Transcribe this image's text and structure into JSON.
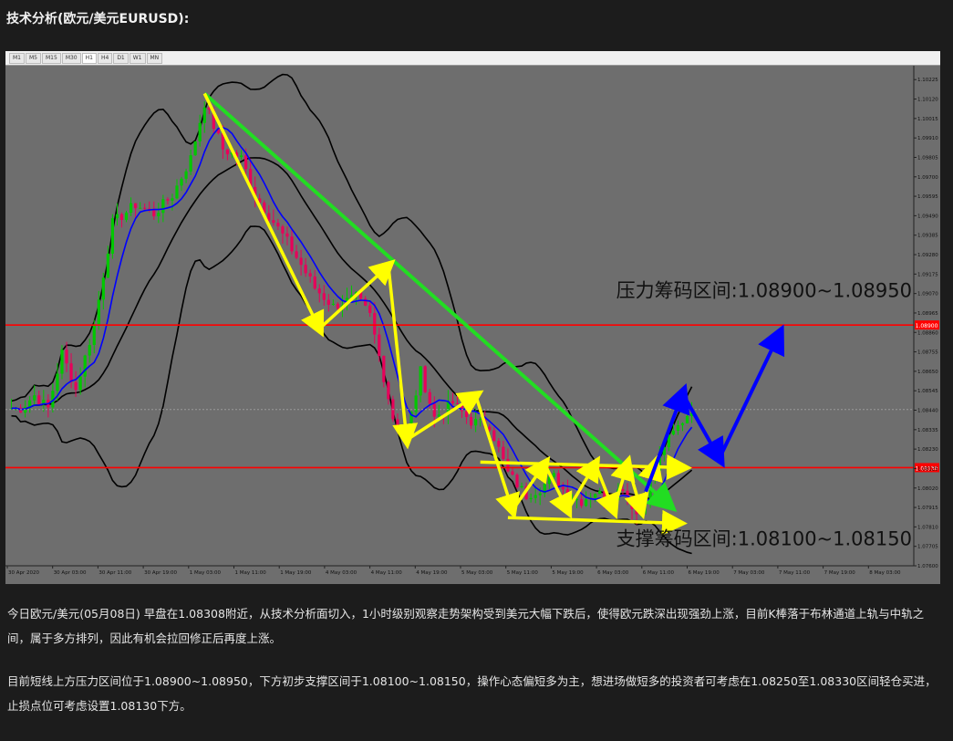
{
  "page": {
    "title": "技术分析(欧元/美元EURUSD):",
    "paragraphs": [
      "今日欧元/美元(05月08日) 早盘在1.08308附近，从技术分析面切入，1小时级别观察走势架构受到美元大幅下跌后，使得欧元跌深出现强劲上涨，目前K棒落于布林通道上轨与中轨之间，属于多方排列，因此有机会拉回修正后再度上涨。",
      "目前短线上方压力区间位于1.08900~1.08950，下方初步支撑区间于1.08100~1.08150，操作心态偏短多为主，想进场做短多的投资者可考虑在1.08250至1.08330区间轻仓买进，止损点位可考虑设置1.08130下方。"
    ]
  },
  "toolbar": {
    "timeframes": [
      "M1",
      "M5",
      "M15",
      "M30",
      "H1",
      "H4",
      "D1",
      "W1",
      "MN"
    ],
    "active": "H1"
  },
  "colors": {
    "background": "#6e6e6e",
    "bull_candle": "#00c800",
    "bear_candle": "#e8005a",
    "bollinger": "#000000",
    "ma": "#0000ff",
    "level_line": "#ff0000",
    "trend_line": "#22dd22",
    "pattern_line": "#ffff00",
    "forecast_line": "#0000ff"
  },
  "chart_data": {
    "type": "candlestick",
    "symbol": "EURUSD",
    "timeframe": "H1",
    "ylim": [
      1.076,
      1.103
    ],
    "y_ticks": [
      1.10225,
      1.1012,
      1.10015,
      1.0991,
      1.09805,
      1.097,
      1.09595,
      1.0949,
      1.09385,
      1.0928,
      1.09175,
      1.0907,
      1.08965,
      1.0886,
      1.08755,
      1.0865,
      1.08545,
      1.0844,
      1.08335,
      1.0823,
      1.08125,
      1.0802,
      1.07915,
      1.0781,
      1.07705,
      1.076
    ],
    "x_ticks": [
      "30 Apr 2020",
      "30 Apr 03:00",
      "30 Apr 11:00",
      "30 Apr 19:00",
      "1 May 03:00",
      "1 May 11:00",
      "1 May 19:00",
      "4 May 03:00",
      "4 May 11:00",
      "4 May 19:00",
      "5 May 03:00",
      "5 May 11:00",
      "5 May 19:00",
      "6 May 03:00",
      "6 May 11:00",
      "6 May 19:00",
      "7 May 03:00",
      "7 May 11:00",
      "7 May 19:00",
      "8 May 03:00"
    ],
    "current_price": 1.08444,
    "levels": [
      {
        "price": 1.089,
        "price_tag": "1.08900"
      },
      {
        "price": 1.0813,
        "price_tag": "1.08130"
      }
    ],
    "annotations": [
      {
        "text": "压力筹码区间:1.08900~1.08950",
        "price": 1.0905
      },
      {
        "text": "支撑筹码区间:1.08100~1.08150",
        "price": 1.0771
      }
    ],
    "pivots": [
      {
        "t": 2,
        "p": 1.0845
      },
      {
        "t": 5,
        "p": 1.0852
      },
      {
        "t": 8,
        "p": 1.0845
      },
      {
        "t": 11,
        "p": 1.0875
      },
      {
        "t": 14,
        "p": 1.0855
      },
      {
        "t": 18,
        "p": 1.089
      },
      {
        "t": 22,
        "p": 1.0945
      },
      {
        "t": 27,
        "p": 1.0955
      },
      {
        "t": 31,
        "p": 1.095
      },
      {
        "t": 35,
        "p": 1.096
      },
      {
        "t": 39,
        "p": 1.098
      },
      {
        "t": 42,
        "p": 1.101
      },
      {
        "t": 46,
        "p": 1.0985
      },
      {
        "t": 50,
        "p": 1.098
      },
      {
        "t": 53,
        "p": 1.096
      },
      {
        "t": 60,
        "p": 1.0935
      },
      {
        "t": 66,
        "p": 1.091
      },
      {
        "t": 70,
        "p": 1.09
      },
      {
        "t": 75,
        "p": 1.0905
      },
      {
        "t": 78,
        "p": 1.0895
      },
      {
        "t": 83,
        "p": 1.084
      },
      {
        "t": 86,
        "p": 1.083
      },
      {
        "t": 89,
        "p": 1.0865
      },
      {
        "t": 92,
        "p": 1.084
      },
      {
        "t": 96,
        "p": 1.0848
      },
      {
        "t": 100,
        "p": 1.0838
      },
      {
        "t": 104,
        "p": 1.0836
      },
      {
        "t": 108,
        "p": 1.081
      },
      {
        "t": 112,
        "p": 1.0798
      },
      {
        "t": 115,
        "p": 1.0802
      },
      {
        "t": 118,
        "p": 1.0808
      },
      {
        "t": 121,
        "p": 1.0798
      },
      {
        "t": 124,
        "p": 1.0795
      },
      {
        "t": 127,
        "p": 1.08
      },
      {
        "t": 130,
        "p": 1.0796
      },
      {
        "t": 133,
        "p": 1.0803
      },
      {
        "t": 136,
        "p": 1.0788
      },
      {
        "t": 139,
        "p": 1.0805
      },
      {
        "t": 142,
        "p": 1.0825
      },
      {
        "t": 145,
        "p": 1.0835
      },
      {
        "t": 148,
        "p": 1.0845
      }
    ],
    "trend_line": [
      {
        "t": 42,
        "p": 1.1015
      },
      {
        "t": 143,
        "p": 1.0793
      }
    ],
    "zigzag": [
      {
        "t": 42,
        "p": 1.1015
      },
      {
        "t": 67,
        "p": 1.0888
      },
      {
        "t": 82,
        "p": 1.0922
      },
      {
        "t": 86,
        "p": 1.0828
      },
      {
        "t": 101,
        "p": 1.0852
      },
      {
        "t": 109,
        "p": 1.079
      },
      {
        "t": 116,
        "p": 1.0815
      },
      {
        "t": 121,
        "p": 1.079
      },
      {
        "t": 127,
        "p": 1.0815
      },
      {
        "t": 131,
        "p": 1.079
      },
      {
        "t": 134,
        "p": 1.0815
      },
      {
        "t": 137,
        "p": 1.079
      },
      {
        "t": 140,
        "p": 1.0815
      }
    ],
    "range_top": [
      {
        "t": 102,
        "p": 1.0816
      },
      {
        "t": 146,
        "p": 1.0813
      }
    ],
    "range_bottom": [
      {
        "t": 108,
        "p": 1.0786
      },
      {
        "t": 145,
        "p": 1.0783
      }
    ],
    "forecast": [
      {
        "t": 138,
        "p": 1.08
      },
      {
        "t": 146,
        "p": 1.0853
      },
      {
        "t": 154,
        "p": 1.0818
      },
      {
        "t": 167,
        "p": 1.0885
      }
    ],
    "n_bars": 196
  }
}
